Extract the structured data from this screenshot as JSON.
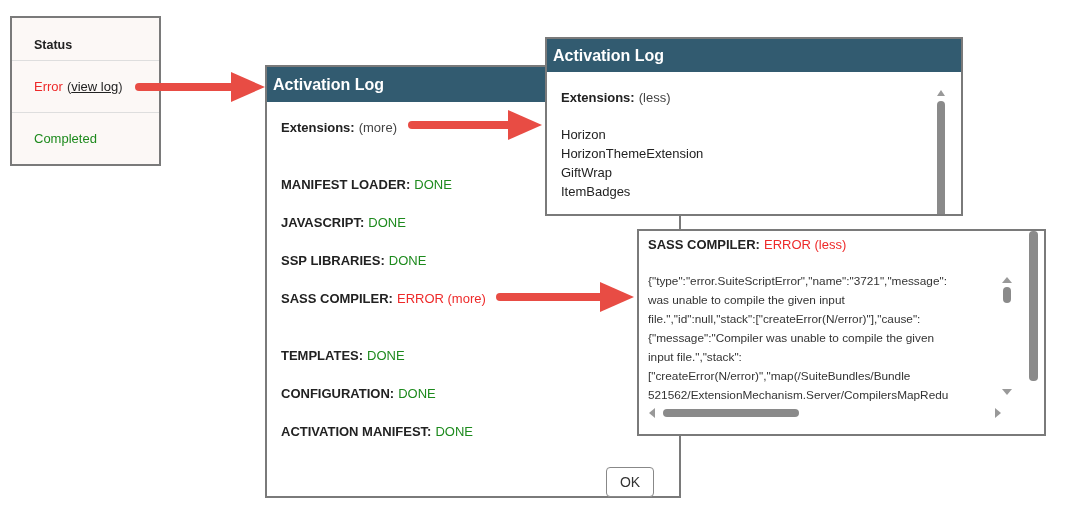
{
  "status_panel": {
    "heading": "Status",
    "rows": [
      {
        "kind": "error",
        "status": "Error",
        "link_before": "(",
        "link": "view log",
        "link_after": ")"
      },
      {
        "kind": "done",
        "status": "Completed"
      }
    ]
  },
  "log_dialog": {
    "title": "Activation Log",
    "extensions": {
      "label": "Extensions:",
      "toggle": "(more)"
    },
    "steps": [
      {
        "kind": "done",
        "name": "MANIFEST LOADER:",
        "result": "DONE"
      },
      {
        "kind": "done",
        "name": "JAVASCRIPT:",
        "result": "DONE"
      },
      {
        "kind": "done",
        "name": "SSP LIBRARIES:",
        "result": "DONE"
      },
      {
        "kind": "error",
        "name": "SASS COMPILER:",
        "result": "ERROR (more)"
      },
      {
        "kind": "done",
        "name": "TEMPLATES:",
        "result": "DONE"
      },
      {
        "kind": "done",
        "name": "CONFIGURATION:",
        "result": "DONE"
      },
      {
        "kind": "done",
        "name": "ACTIVATION MANIFEST:",
        "result": "DONE"
      }
    ],
    "ok_button": "OK"
  },
  "extensions_popup": {
    "title": "Activation Log",
    "label": "Extensions:",
    "toggle": "(less)",
    "items": [
      "Horizon",
      "HorizonThemeExtension",
      "GiftWrap",
      "ItemBadges"
    ]
  },
  "sass_popup": {
    "kind": "error",
    "name": "SASS COMPILER:",
    "result": "ERROR (less)",
    "lines": [
      "{\"type\":\"error.SuiteScriptError\",\"name\":\"3721\",\"message\":",
      "was unable to compile the given input",
      "file.\",\"id\":null,\"stack\":[\"createError(N/error)\"],\"cause\":",
      "{\"message\":\"Compiler was unable to compile the given",
      "input file.\",\"stack\":",
      "[\"createError(N/error)\",\"map(/SuiteBundles/Bundle",
      "521562/ExtensionMechanism.Server/CompilersMapRedu"
    ]
  }
}
